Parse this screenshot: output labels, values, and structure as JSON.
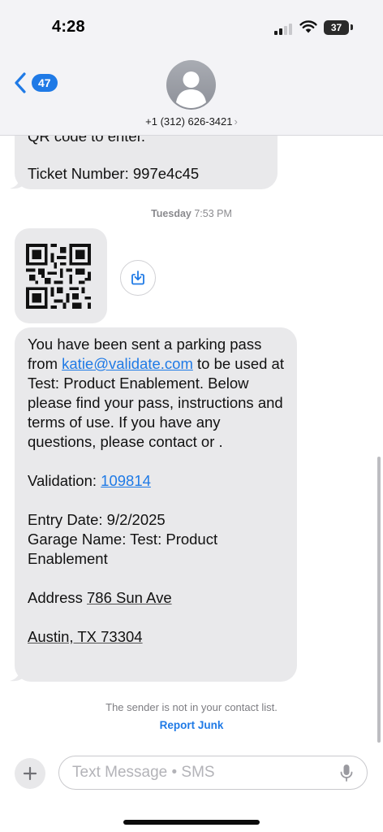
{
  "status_bar": {
    "time": "4:28",
    "battery": "37"
  },
  "nav": {
    "back_count": "47",
    "contact_number": "+1 (312) 626-3421",
    "contact_chevron": "›"
  },
  "messages": {
    "top_partial_line": "QR code to enter.",
    "ticket_line": "Ticket Number: 997e4c45",
    "timestamp_day": "Tuesday",
    "timestamp_time": "7:53 PM",
    "main": {
      "p1_a": "You have been sent a parking pass from ",
      "email": "katie@validate.com",
      "p1_b": " to be used at Test: Product Enablement. Below please find your pass, instructions and terms of use. If you have any questions, please contact  or .",
      "validation_label": "Validation: ",
      "validation_code": "109814",
      "entry_date": "Entry Date: 9/2/2025",
      "garage_name": "Garage Name: Test: Product Enablement",
      "address_label": "Address ",
      "address_street": "786 Sun Ave",
      "address_city": "Austin, TX 73304"
    }
  },
  "footer": {
    "notice": "The sender is not in your contact list.",
    "report_junk": "Report Junk"
  },
  "composer": {
    "placeholder": "Text Message • SMS"
  },
  "colors": {
    "accent": "#1f7ae6",
    "bubble": "#e9e9eb",
    "header": "#f3f3f6"
  },
  "icons": [
    "back-chevron-icon",
    "avatar-icon",
    "save-icon",
    "plus-icon",
    "microphone-icon",
    "wifi-icon",
    "signal-icon",
    "battery-icon",
    "qr-code"
  ]
}
